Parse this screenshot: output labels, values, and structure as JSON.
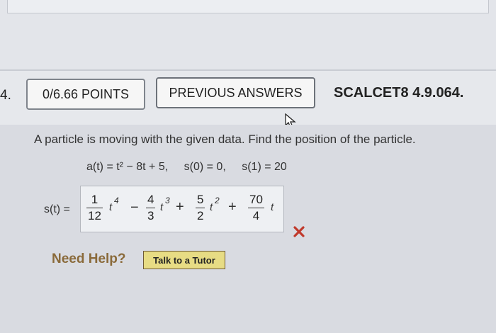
{
  "question": {
    "number": "4.",
    "points_label": "0/6.66 POINTS",
    "previous_answers_label": "PREVIOUS ANSWERS",
    "code": "SCALCET8 4.9.064.",
    "prompt": "A particle is moving with the given data. Find the position of the particle.",
    "given": [
      "a(t) = t² − 8t + 5,",
      "s(0) = 0,",
      "s(1) = 20"
    ]
  },
  "answer": {
    "label": "s(t) =",
    "terms": [
      {
        "num": "1",
        "den": "12",
        "var": "t",
        "exp": "4"
      },
      {
        "num": "4",
        "den": "3",
        "var": "t",
        "exp": "3"
      },
      {
        "num": "5",
        "den": "2",
        "var": "t",
        "exp": "2"
      },
      {
        "num": "70",
        "den": "4",
        "var": "t",
        "exp": ""
      }
    ],
    "operators": [
      "−",
      "+",
      "+"
    ],
    "status": "incorrect",
    "status_color": "#c0392b"
  },
  "help": {
    "need_help_label": "Need Help?",
    "tutor_button_label": "Talk to a Tutor"
  }
}
